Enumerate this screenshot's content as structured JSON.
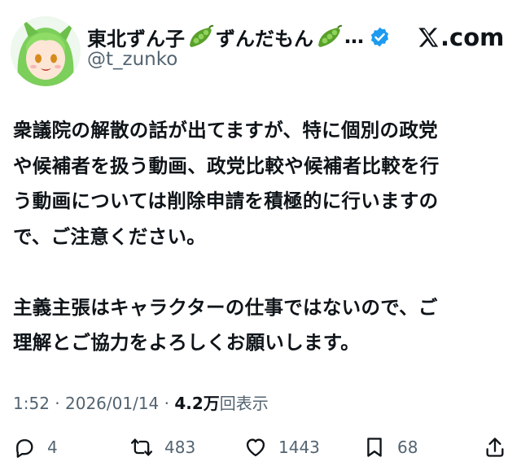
{
  "header": {
    "name_part1": "東北ずん子",
    "name_part2": "ずんだもん",
    "name_ellipsis": "…",
    "handle": "@t_zunko",
    "site": ".com"
  },
  "tweet": {
    "body": "衆議院の解散の話が出てますが、特に個別の政党\nや候補者を扱う動画、政党比較や候補者比較を行\nう動画については削除申請を積極的に行いますの\nで、ご注意ください。\n\n主義主張はキャラクターの仕事ではないので、ご\n理解とご協力をよろしくお願いします。"
  },
  "meta": {
    "time": "1:52",
    "sep": " · ",
    "date": "2026/01/14",
    "views_count": "4.2万",
    "views_label": "回表示"
  },
  "actions": {
    "replies": "4",
    "reposts": "483",
    "likes": "1443",
    "bookmarks": "68"
  },
  "colors": {
    "verified": "#1d9bf0",
    "pea": "#5aa02c",
    "muted": "#536471"
  }
}
